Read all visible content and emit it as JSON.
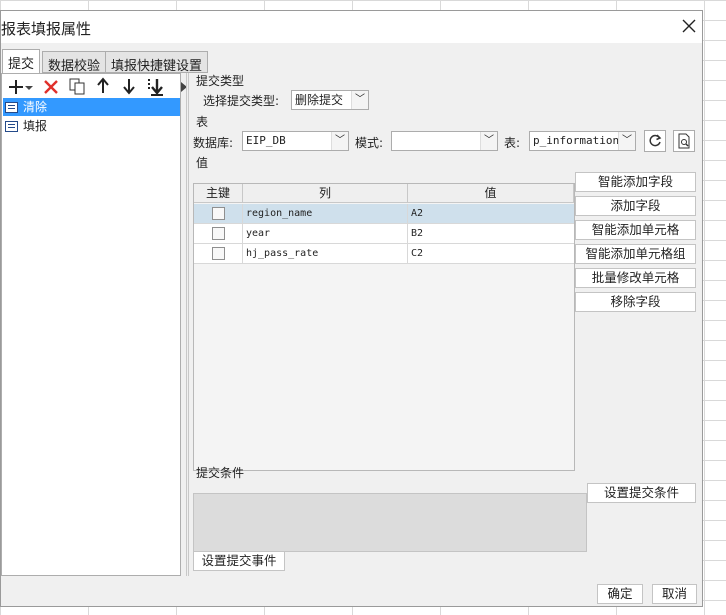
{
  "dialog": {
    "title": "报表填报属性"
  },
  "tabs": [
    {
      "label": "提交"
    },
    {
      "label": "数据校验"
    },
    {
      "label": "填报快捷键设置"
    }
  ],
  "toolbar": [
    "add-icon",
    "add-dropdown-icon",
    "delete-icon",
    "copy-icon",
    "move-up-icon",
    "move-down-icon",
    "move-bottom-icon",
    "expand-icon"
  ],
  "tree": {
    "items": [
      {
        "label": "清除"
      },
      {
        "label": "填报"
      }
    ]
  },
  "submit_type": {
    "section_label": "提交类型",
    "select_label": "选择提交类型:",
    "value": "删除提交"
  },
  "table_section": {
    "section_label": "表",
    "db_label": "数据库:",
    "db_value": "EIP_DB",
    "mode_label": "模式:",
    "mode_value": "",
    "table_label": "表:",
    "table_value": "p_information"
  },
  "values_section": {
    "section_label": "值",
    "headers": {
      "key": "主键",
      "column": "列",
      "value": "值"
    },
    "rows": [
      {
        "column": "region_name",
        "value": "A2"
      },
      {
        "column": "year",
        "value": "B2"
      },
      {
        "column": "hj_pass_rate",
        "value": "C2"
      }
    ],
    "buttons": {
      "smart_add_field": "智能添加字段",
      "add_field": "添加字段",
      "smart_add_cell": "智能添加单元格",
      "smart_add_cell_group": "智能添加单元格组",
      "batch_modify_cell": "批量修改单元格",
      "remove_field": "移除字段"
    }
  },
  "condition": {
    "section_label": "提交条件",
    "button": "设置提交条件"
  },
  "event_button": "设置提交事件",
  "footer": {
    "ok": "确定",
    "cancel": "取消"
  }
}
